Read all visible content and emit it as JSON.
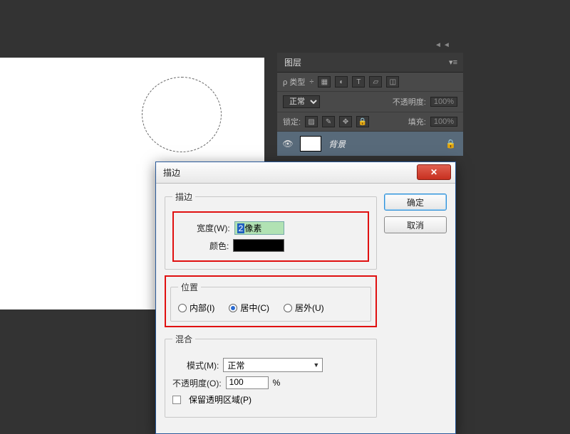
{
  "layersPanel": {
    "title": "图层",
    "kindLabel": "ρ 类型",
    "blendMode": "正常",
    "opacityLabel": "不透明度:",
    "opacityValue": "100%",
    "lockLabel": "锁定:",
    "fillLabel": "填充:",
    "fillValue": "100%",
    "layerName": "背景"
  },
  "dialog": {
    "title": "描边",
    "ok": "确定",
    "cancel": "取消",
    "strokeGroup": "描边",
    "widthLabel": "宽度(W):",
    "widthValue": "2",
    "widthUnit": "像素",
    "colorLabel": "颜色:",
    "locationGroup": "位置",
    "locInside": "内部(I)",
    "locCenter": "居中(C)",
    "locOutside": "居外(U)",
    "blendGroup": "混合",
    "modeLabel": "模式(M):",
    "modeValue": "正常",
    "opacityLabel": "不透明度(O):",
    "opacityValue": "100",
    "opacityPct": "%",
    "preserveLabel": "保留透明区域(P)"
  }
}
